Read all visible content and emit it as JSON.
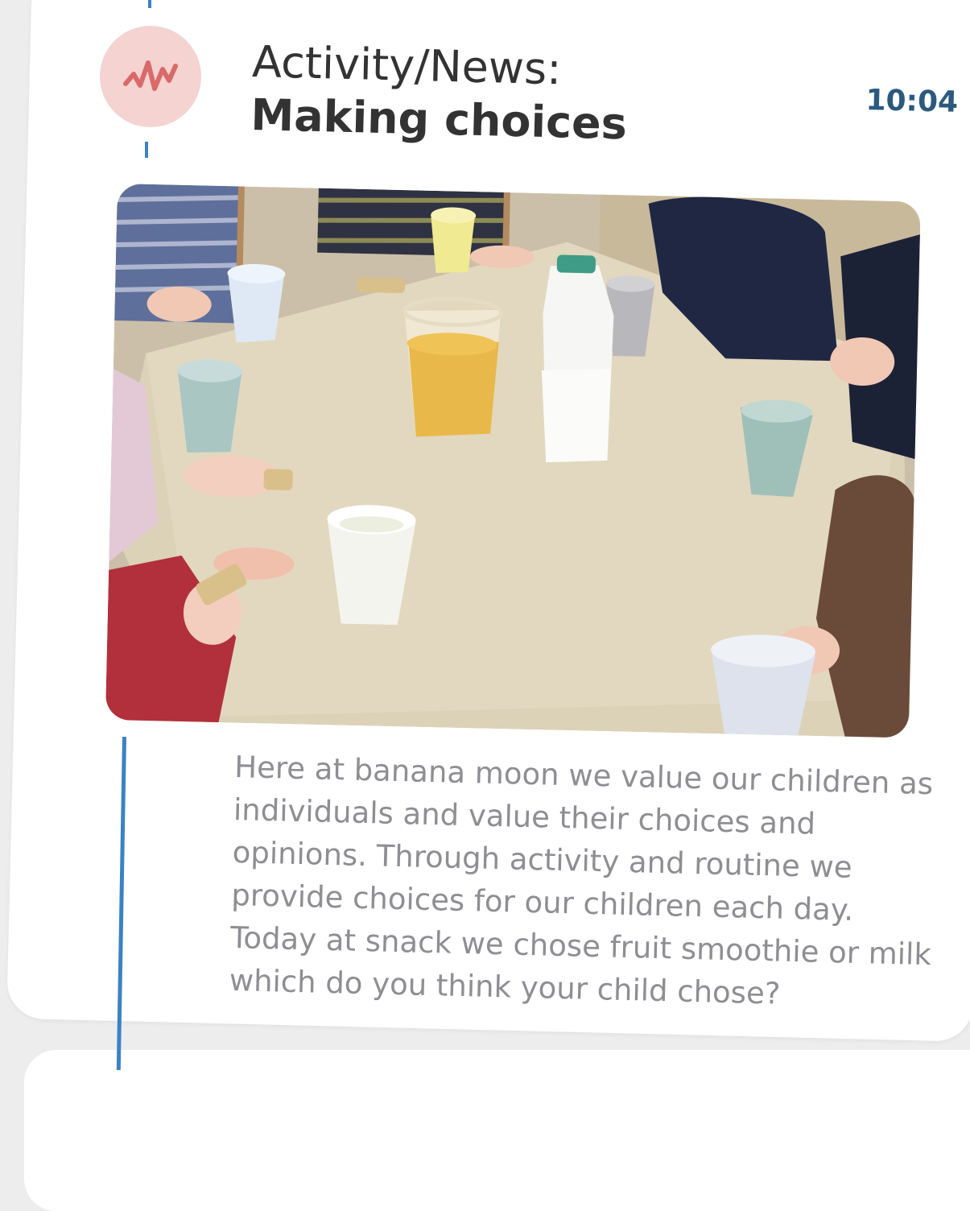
{
  "post": {
    "category_label": "Activity/News:",
    "title": "Making choices",
    "time": "10:04",
    "icon": "activity-wave-icon",
    "accent_color": "#3b82c4",
    "icon_bg_color": "#f4d3d1",
    "icon_color": "#d86a6a",
    "photo_subject": "snack-table-photo",
    "description": "Here at banana moon we value our children as individuals and value their choices and opinions. Through activity and routine we provide choices for our children each day. Today at snack we chose fruit smoothie or milk which do you think your child chose?"
  }
}
